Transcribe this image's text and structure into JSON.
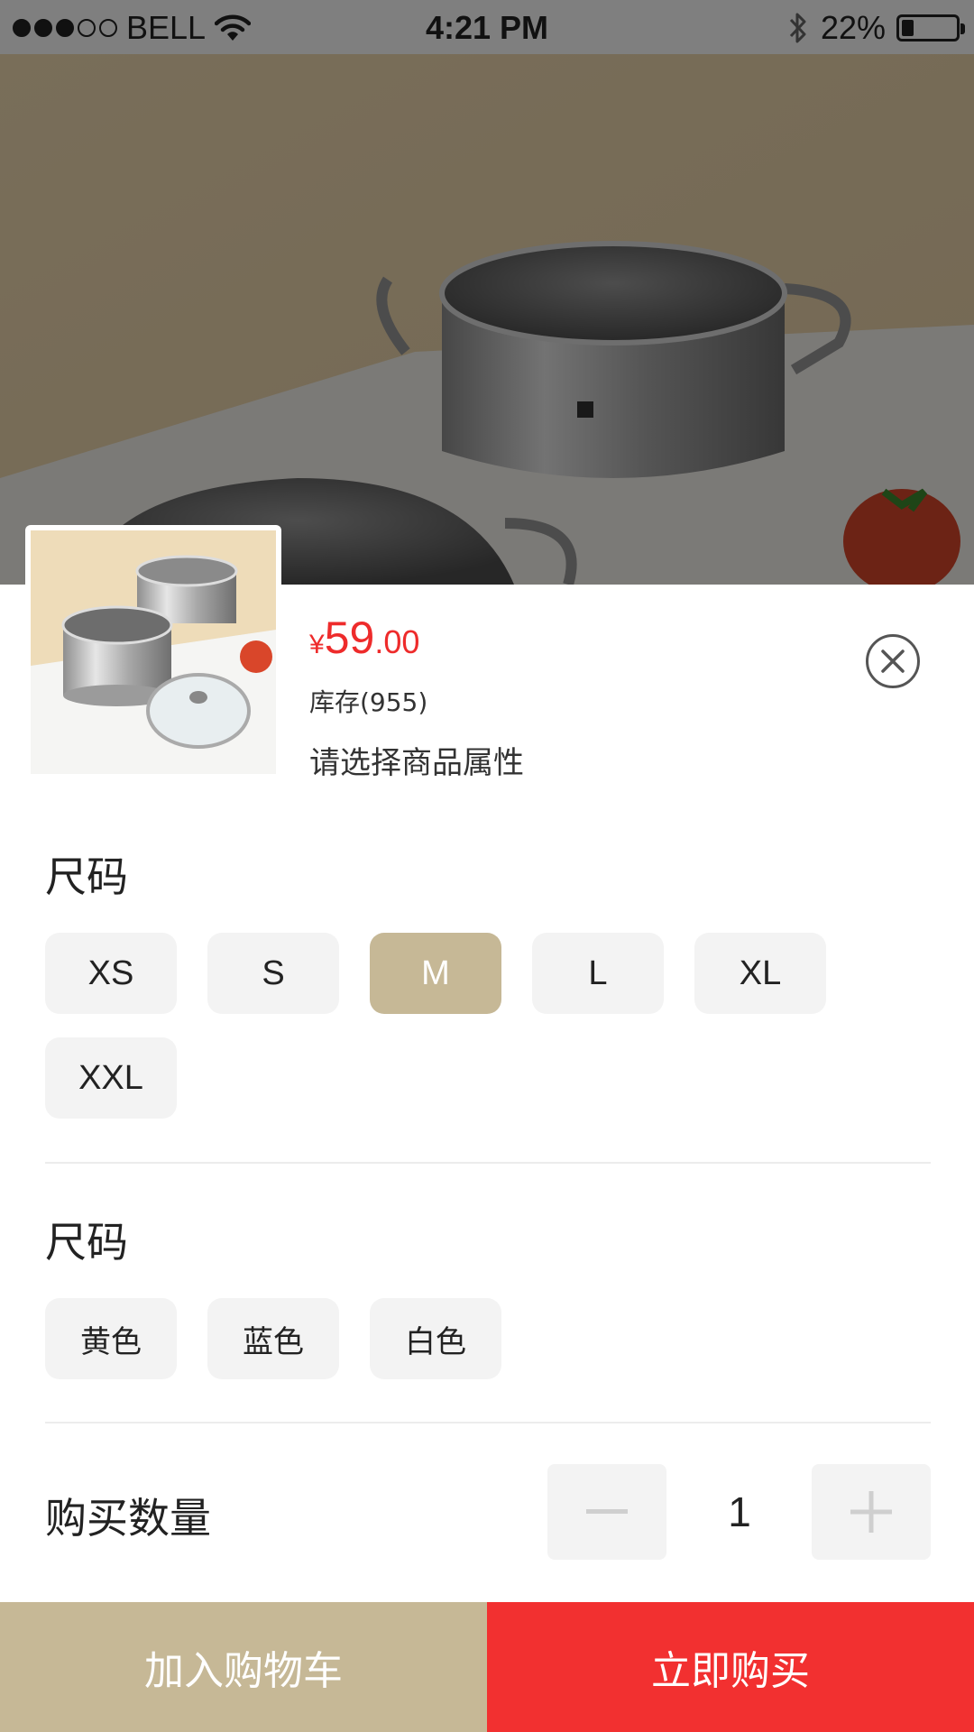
{
  "status_bar": {
    "carrier": "BELL",
    "time": "4:21 PM",
    "battery_text": "22%",
    "battery_level": 0.22
  },
  "product": {
    "currency": "¥",
    "price_integer": "59",
    "price_decimal": ".00",
    "stock": "库存(955)",
    "prompt": "请选择商品属性"
  },
  "size_section": {
    "title": "尺码",
    "options": [
      "XS",
      "S",
      "M",
      "L",
      "XL",
      "XXL"
    ],
    "selected": "M"
  },
  "color_section": {
    "title": "尺码",
    "options": [
      "黄色",
      "蓝色",
      "白色"
    ]
  },
  "quantity": {
    "label": "购买数量",
    "value": "1"
  },
  "actions": {
    "add_to_cart": "加入购物车",
    "buy_now": "立即购买"
  },
  "colors": {
    "accent_gold": "#c6b896",
    "price_red": "#ee2b2b",
    "buy_red": "#f23030",
    "chip_bg": "#f3f3f3"
  },
  "icons": [
    "signal-dots-icon",
    "wifi-icon",
    "bluetooth-icon",
    "battery-icon",
    "close-icon",
    "minus-icon",
    "plus-icon"
  ]
}
